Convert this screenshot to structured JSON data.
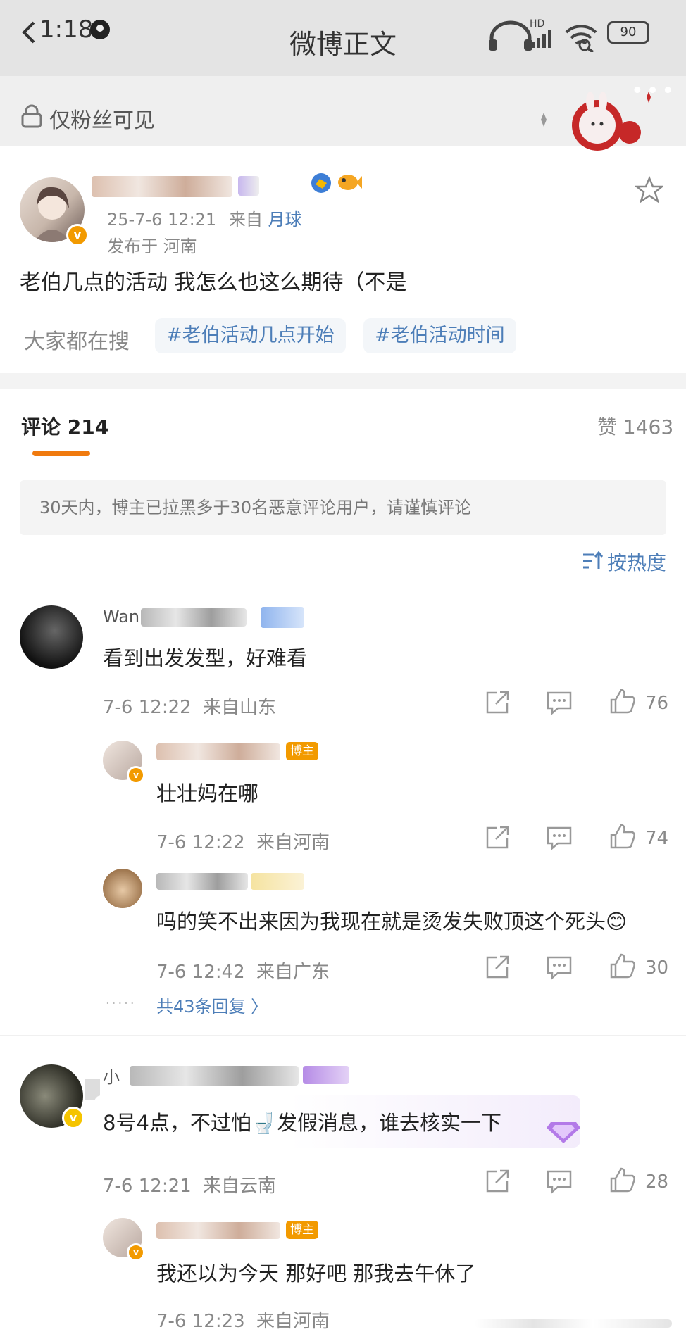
{
  "status": {
    "time": "1:18",
    "network": "HD",
    "battery": "90"
  },
  "nav": {
    "title": "微博正文",
    "more": "•••"
  },
  "visibility": {
    "label": "仅粉丝可见"
  },
  "post": {
    "timestamp": "25-7-6 12:21",
    "source_prefix": "来自",
    "source": "月球",
    "location": "发布于 河南",
    "text": "老伯几点的活动 我怎么也这么期待（不是",
    "search_label": "大家都在搜",
    "hashtags": [
      "#老伯活动几点开始",
      "#老伯活动时间"
    ]
  },
  "tabs": {
    "comments": "评论 214",
    "likes": "赞 1463"
  },
  "notice": "30天内，博主已拉黑多于30名恶意评论用户，请谨慎评论",
  "sort_label": "按热度",
  "author_tag": "博主",
  "comments": [
    {
      "name_hint": "Wan",
      "text": "看到出发发型，好难看",
      "time": "7-6 12:22",
      "location": "来自山东",
      "likes": "76",
      "replies": [
        {
          "text": "壮壮妈在哪",
          "time": "7-6 12:22",
          "location": "来自河南",
          "likes": "74",
          "is_author": true
        },
        {
          "text": "吗的笑不出来因为我现在就是烫发失败顶这个死头😊",
          "time": "7-6 12:42",
          "location": "来自广东",
          "likes": "30",
          "is_author": false
        }
      ],
      "replies_total": "共43条回复 〉"
    },
    {
      "name_hint": "小",
      "text": "8号4点，不过怕🚽发假消息，谁去核实一下",
      "time": "7-6 12:21",
      "location": "来自云南",
      "likes": "28",
      "replies": [
        {
          "text": "我还以为今天 那好吧 那我去午休了",
          "time": "7-6 12:23",
          "location": "来自河南",
          "is_author": true
        }
      ]
    }
  ],
  "colors": {
    "accent": "#f07a0e",
    "link": "#4d7eb8",
    "vip": "#f29a00"
  }
}
